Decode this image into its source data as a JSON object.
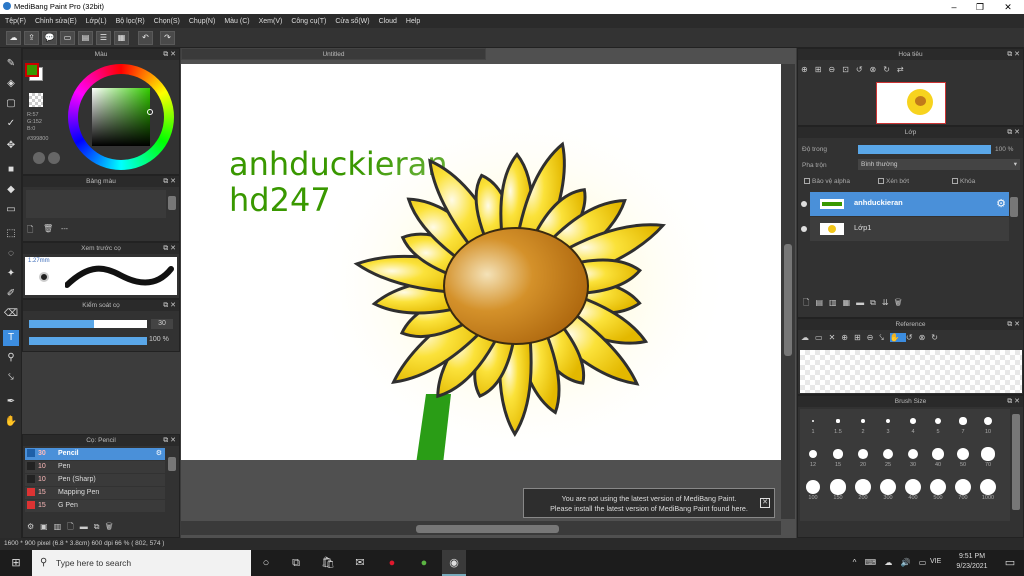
{
  "window": {
    "title": "MediBang Paint Pro (32bit)"
  },
  "menu": [
    "Tệp(F)",
    "Chỉnh sửa(E)",
    "Lớp(L)",
    "Bộ lọc(R)",
    "Chọn(S)",
    "Chụp(N)",
    "Màu (C)",
    "Xem(V)",
    "Công cụ(T)",
    "Cửa sổ(W)",
    "Cloud",
    "Help"
  ],
  "panels": {
    "color": "Màu",
    "palette": "Bảng màu",
    "preview": "Xem trước cọ",
    "control": "Kiểm soát cọ",
    "brush": "Cọ: Pencil",
    "navigator": "Hoa tiêu",
    "layer": "Lớp",
    "reference": "Reference",
    "brush_size": "Brush Size"
  },
  "color": {
    "r": "R:57",
    "g": "G:152",
    "b": "B:0",
    "hex": "#399800",
    "fg": "#399800",
    "bg": "#ffffff"
  },
  "palette": {
    "name": "---"
  },
  "preview": {
    "size": "1.27mm"
  },
  "control": {
    "size": "30",
    "opacity": "100 %"
  },
  "brushes": [
    {
      "size": "30",
      "name": "Pencil",
      "color": "#1e5fa8",
      "sel": true
    },
    {
      "size": "10",
      "name": "Pen",
      "color": "#222"
    },
    {
      "size": "10",
      "name": "Pen (Sharp)",
      "color": "#222"
    },
    {
      "size": "15",
      "name": "Mapping Pen",
      "color": "#d33"
    },
    {
      "size": "15",
      "name": "G Pen",
      "color": "#d33"
    }
  ],
  "canvas": {
    "tab": "Untitled",
    "text1": "anhduckieran",
    "text2": "hd247",
    "text_color": "#399800"
  },
  "layer": {
    "opacity_label": "Độ trong",
    "opacity": "100 %",
    "blend_label": "Pha trộn",
    "blend": "Bình thường",
    "alpha": "Bảo vệ alpha",
    "clip": "Xén bớt",
    "lock": "Khóa",
    "layers": [
      {
        "name": "anhduckieran",
        "sel": true
      },
      {
        "name": "Lớp1",
        "sel": false
      }
    ]
  },
  "brush_sizes": [
    "1",
    "1.5",
    "2",
    "3",
    "4",
    "5",
    "7",
    "10",
    "12",
    "15",
    "20",
    "25",
    "30",
    "40",
    "50",
    "70",
    "100",
    "150",
    "200",
    "300",
    "400",
    "500",
    "700",
    "1000"
  ],
  "notification": {
    "line1": "You are not using the latest version of MediBang Paint.",
    "line2": "Please install the latest version of MediBang Paint found here."
  },
  "status": "1600 * 900 pixel  (6.8 * 3.8cm)  600 dpi  66 %  ( 802, 574 )",
  "taskbar": {
    "search": "Type here to search",
    "lang": "VIE",
    "time": "9:51 PM",
    "date": "9/23/2021"
  }
}
